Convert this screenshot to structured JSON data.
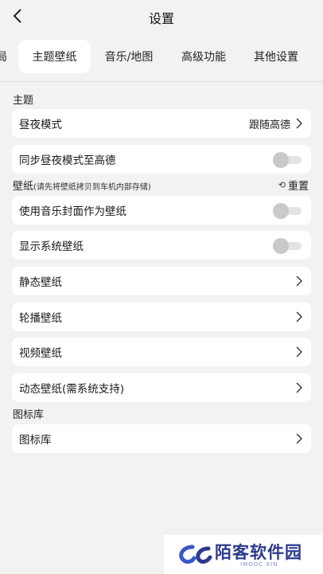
{
  "header": {
    "title": "设置"
  },
  "tabs": [
    {
      "label": "局"
    },
    {
      "label": "主题壁纸"
    },
    {
      "label": "音乐/地图"
    },
    {
      "label": "高级功能"
    },
    {
      "label": "其他设置"
    }
  ],
  "theme_section": {
    "label": "主题",
    "day_night": {
      "label": "昼夜模式",
      "value": "跟随高德"
    },
    "sync": {
      "label": "同步昼夜模式至高德",
      "enabled": false
    }
  },
  "wallpaper_section": {
    "label": "壁纸",
    "note": "(请先将壁纸拷贝到车机内部存储)",
    "reset": "重置",
    "items": {
      "music_cover": {
        "label": "使用音乐封面作为壁纸",
        "enabled": false
      },
      "system": {
        "label": "显示系统壁纸",
        "enabled": false
      },
      "static": {
        "label": "静态壁纸"
      },
      "carousel": {
        "label": "轮播壁纸"
      },
      "video": {
        "label": "视频壁纸"
      },
      "dynamic": {
        "label": "动态壁纸(需系统支持)"
      }
    }
  },
  "icon_section": {
    "label": "图标库",
    "item": {
      "label": "图标库"
    }
  },
  "watermark": {
    "text": "陌客软件园",
    "sub": "IMOOC XIN"
  },
  "colors": {
    "background": "#f2f2f2",
    "card": "#ffffff",
    "watermark_brand": "#2d3a8c"
  }
}
